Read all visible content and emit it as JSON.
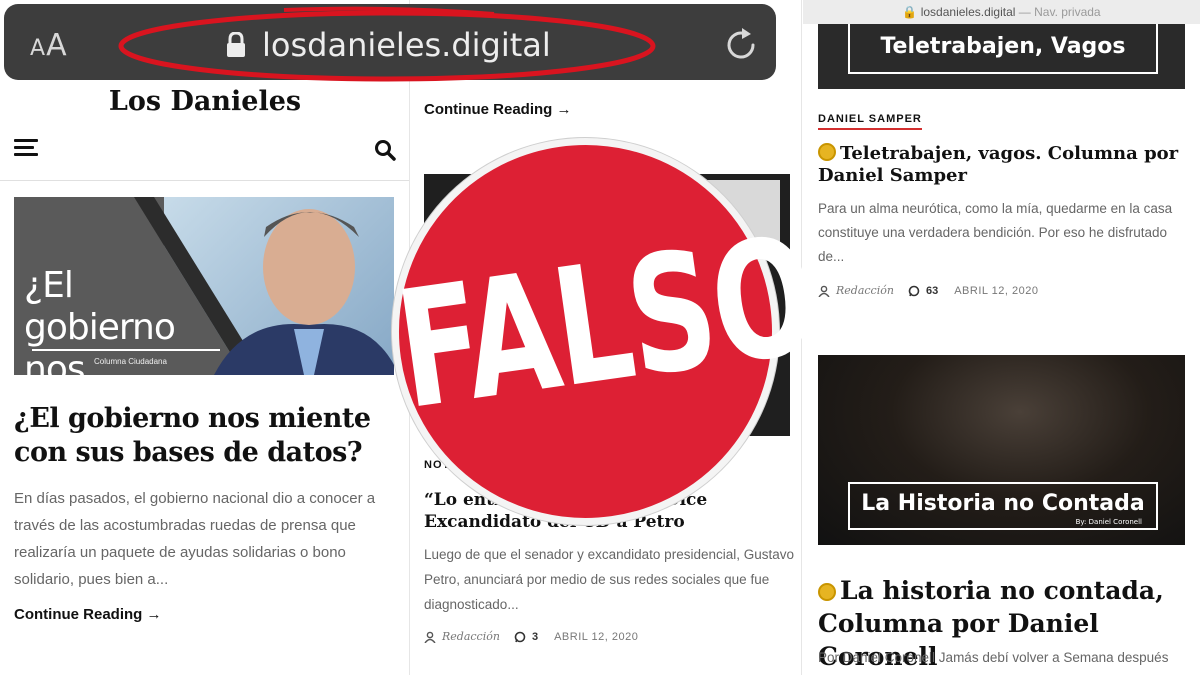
{
  "browser": {
    "text_size_label": "AA",
    "domain": "losdanieles.digital",
    "private_topbar_domain": "losdanieles.digital",
    "private_topbar_mode": "— Nav. privada"
  },
  "panel1": {
    "site_title": "Los Danieles",
    "hero_image_title": "¿El gobierno nos miente?",
    "hero_image_caption": "Columna Ciudadana",
    "headline": "¿El gobierno nos miente con sus bases de datos?",
    "excerpt": "En días pasados, el gobierno nacional dio a conocer a través de las acostumbradas ruedas de prensa que realizaría un paquete de ayudas solidarias o bono solidario, pues bien a...",
    "continue_label": "Continue Reading →"
  },
  "panel2": {
    "continue_label": "Continue Reading →",
    "category": "NOTI",
    "headline": "“Lo entreg… …acrificio”; Dice Excandidato del CD a Petro",
    "excerpt": "Luego de que el senador y excandidato presidencial, Gustavo Petro, anunciará por medio de sus redes sociales que fue diagnosticado...",
    "meta": {
      "author": "Redacción",
      "comments": "3",
      "date": "ABRIL 12, 2020"
    }
  },
  "panel3": {
    "hero1_title": "Teletrabajen, Vagos",
    "category": "DANIEL SAMPER",
    "headline1": "Teletrabajen, vagos. Columna por Daniel Samper",
    "excerpt1": "Para un alma neurótica, como la mía, quedarme en la casa constituye una verdadera bendición. Por eso he disfrutado de...",
    "meta": {
      "author": "Redacción",
      "comments": "63",
      "date": "ABRIL 12, 2020"
    },
    "hero2_title": "La Historia no Contada",
    "hero2_byline": "By: Daniel Coronell",
    "headline2": "La historia no contada, Columna por Daniel Coronell",
    "excerpt2_start": "Por Daniel Coronell Jamás debí volver a Semana después"
  },
  "stamp": {
    "label": "FALSO",
    "color": "#dd2034"
  },
  "colors": {
    "annotation_red": "#d9141f",
    "category_underline": "#d32f2f"
  }
}
